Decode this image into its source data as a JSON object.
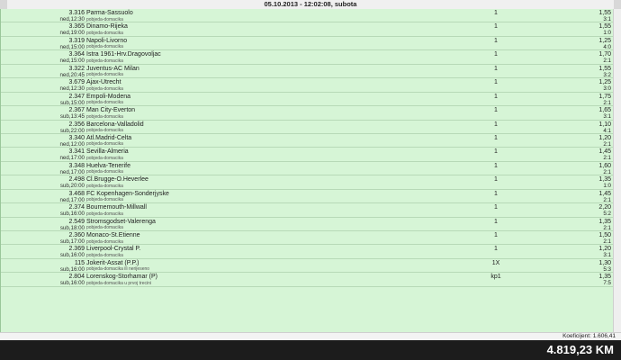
{
  "header": {
    "title": "05.10.2013 - 12:02:08, subota"
  },
  "rows": [
    {
      "num": "3.316",
      "match": "Parma-Sassuolo",
      "datetime": "ned,12:30",
      "type": "pobjeda-domacika",
      "tip": "1",
      "kvota": "1,55",
      "score": "3:1"
    },
    {
      "num": "3.365",
      "match": "Dinamo-Rijeka",
      "datetime": "ned,19:00",
      "type": "pobjeda-domacika",
      "tip": "1",
      "kvota": "1,55",
      "score": "1:0"
    },
    {
      "num": "3.319",
      "match": "Napoli-Livorno",
      "datetime": "ned,15:00",
      "type": "pobjeda-domacika",
      "tip": "1",
      "kvota": "1,25",
      "score": "4:0"
    },
    {
      "num": "3.364",
      "match": "Istra 1961-Hrv.Dragovoljac",
      "datetime": "ned,15:00",
      "type": "pobjeda-domacika",
      "tip": "1",
      "kvota": "1,70",
      "score": "2:1"
    },
    {
      "num": "3.322",
      "match": "Juventus-AC Milan",
      "datetime": "ned,20:45",
      "type": "pobjeda-domacika",
      "tip": "1",
      "kvota": "1,55",
      "score": "3:2"
    },
    {
      "num": "3.679",
      "match": "Ajax-Utrecht",
      "datetime": "ned,12:30",
      "type": "pobjeda-domacika",
      "tip": "1",
      "kvota": "1,25",
      "score": "3:0"
    },
    {
      "num": "2.347",
      "match": "Empoli-Modena",
      "datetime": "sub,15:00",
      "type": "pobjeda-domacika",
      "tip": "1",
      "kvota": "1,75",
      "score": "2:1"
    },
    {
      "num": "2.367",
      "match": "Man City-Everton",
      "datetime": "sub,13:45",
      "type": "pobjeda-domacika",
      "tip": "1",
      "kvota": "1,65",
      "score": "3:1"
    },
    {
      "num": "2.356",
      "match": "Barcelona-Valladolid",
      "datetime": "sub,22:00",
      "type": "pobjeda-domacika",
      "tip": "1",
      "kvota": "1,10",
      "score": "4:1"
    },
    {
      "num": "3.340",
      "match": "Atl.Madrid-Celta",
      "datetime": "ned,12:00",
      "type": "pobjeda-domacika",
      "tip": "1",
      "kvota": "1,20",
      "score": "2:1"
    },
    {
      "num": "3.341",
      "match": "Sevilla-Almeria",
      "datetime": "ned,17:00",
      "type": "pobjeda-domacika",
      "tip": "1",
      "kvota": "1,45",
      "score": "2:1"
    },
    {
      "num": "3.348",
      "match": "Huelva-Tenerife",
      "datetime": "ned,17:00",
      "type": "pobjeda-domacika",
      "tip": "1",
      "kvota": "1,60",
      "score": "2:1"
    },
    {
      "num": "2.498",
      "match": "Cl.Brugge-O.Heverlee",
      "datetime": "sub,20:00",
      "type": "pobjeda-domacika",
      "tip": "1",
      "kvota": "1,35",
      "score": "1:0"
    },
    {
      "num": "3.468",
      "match": "FC Kopenhagen-Sonderjyske",
      "datetime": "ned,17:00",
      "type": "pobjeda-domacika",
      "tip": "1",
      "kvota": "1,45",
      "score": "2:1"
    },
    {
      "num": "2.374",
      "match": "Bournemouth-Millwall",
      "datetime": "sub,16:00",
      "type": "pobjeda-domacika",
      "tip": "1",
      "kvota": "2,20",
      "score": "5:2"
    },
    {
      "num": "2.549",
      "match": "Stromsgodset-Valerenga",
      "datetime": "sub,18:00",
      "type": "pobjeda-domacika",
      "tip": "1",
      "kvota": "1,35",
      "score": "2:1"
    },
    {
      "num": "2.360",
      "match": "Monaco-St.Etienne",
      "datetime": "sub,17:00",
      "type": "pobjeda-domacika",
      "tip": "1",
      "kvota": "1,50",
      "score": "2:1"
    },
    {
      "num": "2.369",
      "match": "Liverpool-Crystal P.",
      "datetime": "sub,16:00",
      "type": "pobjeda-domacika",
      "tip": "1",
      "kvota": "1,20",
      "score": "3:1"
    },
    {
      "num": "115",
      "match": "Jokerit-Assat (P.P.)",
      "datetime": "sub,16:00",
      "type": "pobjeda-domacika ili nerijeseno",
      "tip": "1X",
      "kvota": "1,30",
      "score": "5:3"
    },
    {
      "num": "2.804",
      "match": "Lorenskog-Storhamar (P)",
      "datetime": "sub,16:00",
      "type": "pobjeda-domacika u prvoj trecini",
      "tip": "kp1",
      "kvota": "1,35",
      "score": "7:5"
    }
  ],
  "footer": {
    "coef": "Koeficijent: 1.606,41",
    "total": "4.819,23 KM"
  }
}
